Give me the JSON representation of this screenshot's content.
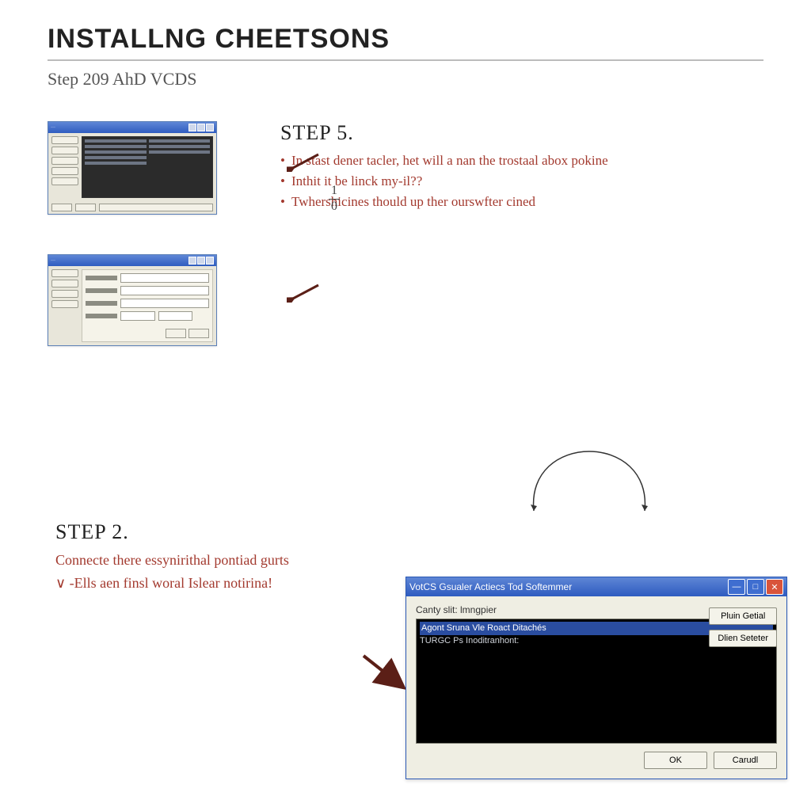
{
  "header": {
    "title": "INSTALLNG CHEETSONS",
    "subtitle": "Step 209 AhD VCDS"
  },
  "step5": {
    "label": "STEP 5.",
    "bullets": [
      "In stast dener tacler, het will a nan the trostaal abox pokine",
      "Inthit it be linck my-il??",
      "Twhershicines thould up ther ourswfter cined"
    ],
    "fraction": {
      "num": "1",
      "den": "0"
    }
  },
  "step2": {
    "label": "STEP 2.",
    "line1": "Connecte there essynirithal pontiad gurts",
    "line2": "∨ -Ells aen finsl woral Islear notirina!"
  },
  "dialog": {
    "title": "VotCS Gsualer Actiecs Tod Softemmer",
    "label": "Canty slit: lmngpier",
    "list_sel": "Agont Sruna Vle Roact Ditachés",
    "list_line": "TURGC Ps Inoditranhont:",
    "buttons": {
      "side1": "Pluin Getial",
      "side2": "Dlien Seteter",
      "ok": "OK",
      "cancel": "Carudl"
    }
  }
}
